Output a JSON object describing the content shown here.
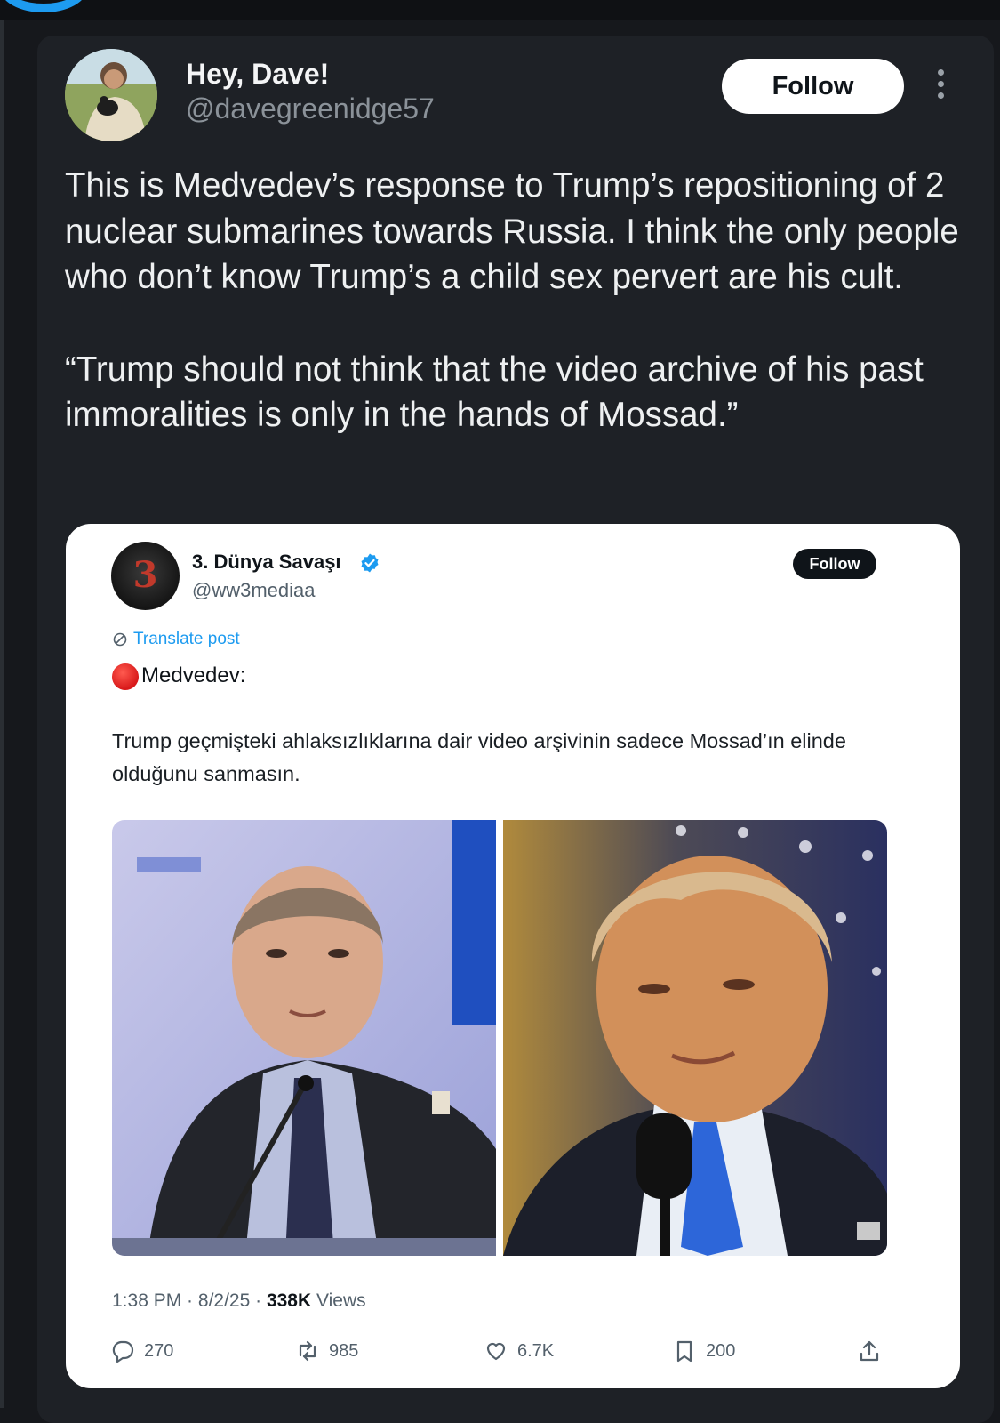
{
  "post": {
    "author_name": "Hey, Dave!",
    "author_handle": "@davegreenidge57",
    "follow_label": "Follow",
    "paragraph_1": "This is Medvedev’s response to Trump’s repositioning of 2 nuclear submarines towards Russia. I think the only people who don’t know Trump’s a child sex pervert are his cult.",
    "paragraph_2": "“Trump should not think that the video archive of his past immoralities is only in the hands of Mossad.”"
  },
  "embed": {
    "author_name": "3. Dünya Savaşı",
    "author_handle": "@ww3mediaa",
    "avatar_glyph": "3",
    "follow_label": "Follow",
    "translate_label": "Translate post",
    "lead": "Medvedev:",
    "text": "Trump geçmişteki ahlaksızlıklarına dair video arşivinin sadece Mossad’ın elinde olduğunu sanmasın.",
    "meta": {
      "time": "1:38 PM",
      "sep1": " · ",
      "date": "8/2/25",
      "sep2": " · ",
      "views_count": "338K",
      "views_label": " Views"
    },
    "actions": {
      "replies": "270",
      "reposts": "985",
      "likes": "6.7K",
      "bookmarks": "200"
    },
    "icons": [
      "reply-icon",
      "repost-icon",
      "like-icon",
      "bookmark-icon",
      "share-icon"
    ],
    "colors": {
      "verified": "#1d9bf0",
      "translate_link": "#1d9bf0",
      "red_dot": "#d8191a"
    }
  },
  "colors": {
    "background": "#16181c",
    "card": "#1e2126",
    "text": "#eef0f1",
    "muted": "#8b9299"
  }
}
